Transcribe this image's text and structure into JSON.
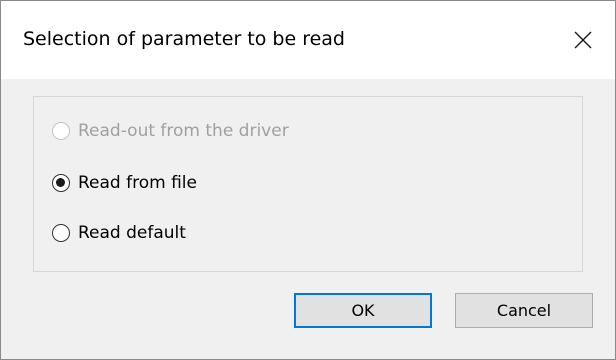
{
  "dialog": {
    "title": "Selection of parameter to be read",
    "close_icon": "close-icon"
  },
  "options": [
    {
      "label": "Read-out from the driver",
      "checked": false,
      "enabled": false
    },
    {
      "label": "Read from file",
      "checked": true,
      "enabled": true
    },
    {
      "label": "Read default",
      "checked": false,
      "enabled": true
    }
  ],
  "buttons": {
    "ok_label": "OK",
    "cancel_label": "Cancel"
  },
  "colors": {
    "default_button_border": "#0078d7",
    "disabled_text": "#a0a0a0"
  }
}
